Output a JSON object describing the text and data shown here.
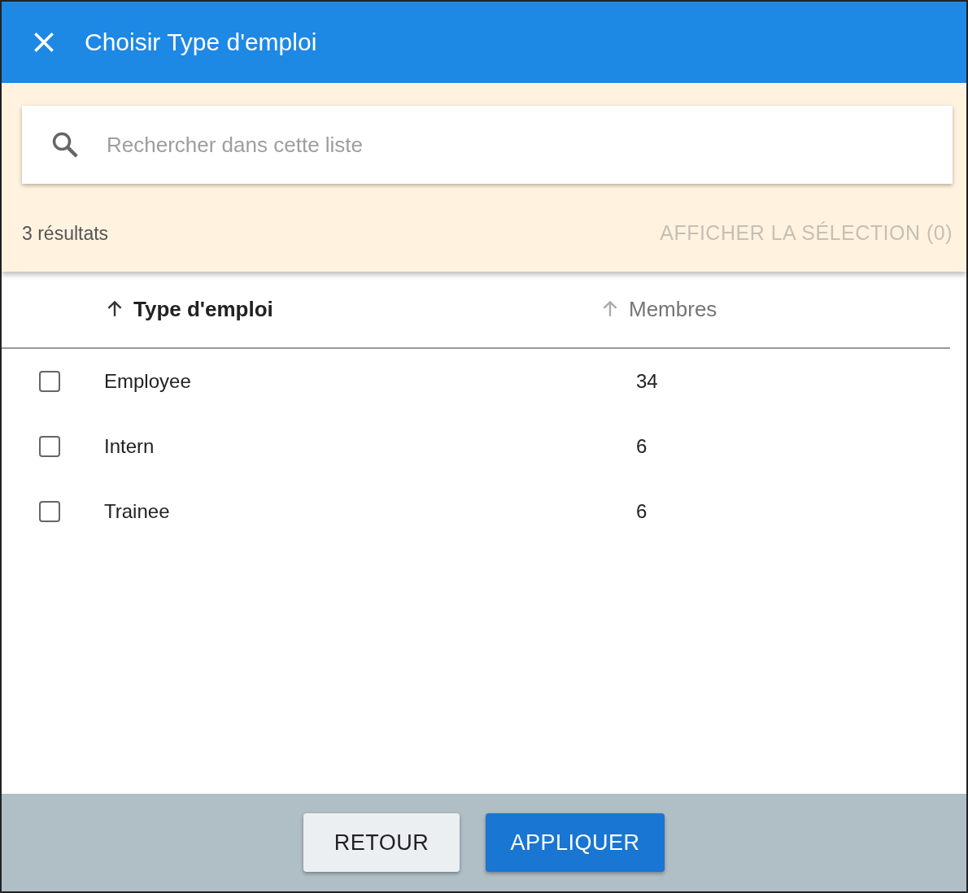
{
  "dialog": {
    "title": "Choisir Type d'emploi"
  },
  "search": {
    "placeholder": "Rechercher dans cette liste"
  },
  "results_count": "3 résultats",
  "show_selection": {
    "label": "AFFICHER LA SÉLECTION (0)",
    "disabled": true
  },
  "columns": [
    {
      "label": "Type d'emploi",
      "selected": true
    },
    {
      "label": "Membres",
      "selected": false
    }
  ],
  "rows": [
    {
      "name": "Employee",
      "members": "34",
      "checked": false
    },
    {
      "name": "Intern",
      "members": "6",
      "checked": false
    },
    {
      "name": "Trainee",
      "members": "6",
      "checked": false
    }
  ],
  "buttons": [
    {
      "label": "RETOUR",
      "kind": "secondary"
    },
    {
      "label": "APPLIQUER",
      "kind": "primary"
    }
  ]
}
